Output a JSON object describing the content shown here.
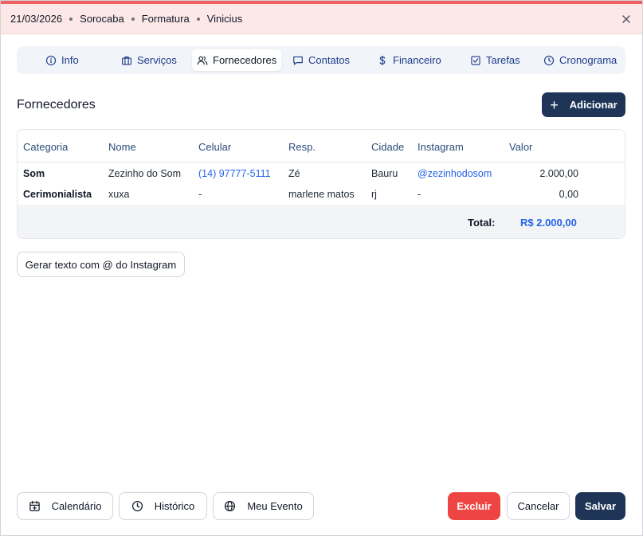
{
  "header": {
    "date": "21/03/2026",
    "city": "Sorocaba",
    "event_type": "Formatura",
    "client": "Vinicius",
    "accent_color": "#ef4444"
  },
  "tabs": [
    {
      "label": "Info",
      "icon": "info-icon"
    },
    {
      "label": "Serviços",
      "icon": "briefcase-icon"
    },
    {
      "label": "Fornecedores",
      "icon": "users-icon",
      "active": true
    },
    {
      "label": "Contatos",
      "icon": "message-icon"
    },
    {
      "label": "Financeiro",
      "icon": "dollar-icon"
    },
    {
      "label": "Tarefas",
      "icon": "checkbox-icon"
    },
    {
      "label": "Cronograma",
      "icon": "clock-icon"
    }
  ],
  "section": {
    "title": "Fornecedores",
    "add_label": "Adicionar"
  },
  "table": {
    "headers": [
      "Categoria",
      "Nome",
      "Celular",
      "Resp.",
      "Cidade",
      "Instagram",
      "Valor"
    ],
    "rows": [
      {
        "categoria": "Som",
        "nome": "Zezinho do Som",
        "celular": "(14) 97777-5111",
        "resp": "Zé",
        "cidade": "Bauru",
        "instagram": "@zezinhodosom",
        "valor": "2.000,00"
      },
      {
        "categoria": "Cerimonialista",
        "nome": "xuxa",
        "celular": "-",
        "resp": "marlene matos",
        "cidade": "rj",
        "instagram": "-",
        "valor": "0,00"
      }
    ],
    "total_label": "Total:",
    "total_value": "R$ 2.000,00"
  },
  "instagram_button": "Gerar texto com @ do Instagram",
  "footer": {
    "calendario": "Calendário",
    "historico": "Histórico",
    "meu_evento": "Meu Evento",
    "excluir": "Excluir",
    "cancelar": "Cancelar",
    "salvar": "Salvar"
  },
  "colors": {
    "primary": "#1e3557",
    "danger": "#ef4444",
    "link": "#2563eb"
  }
}
